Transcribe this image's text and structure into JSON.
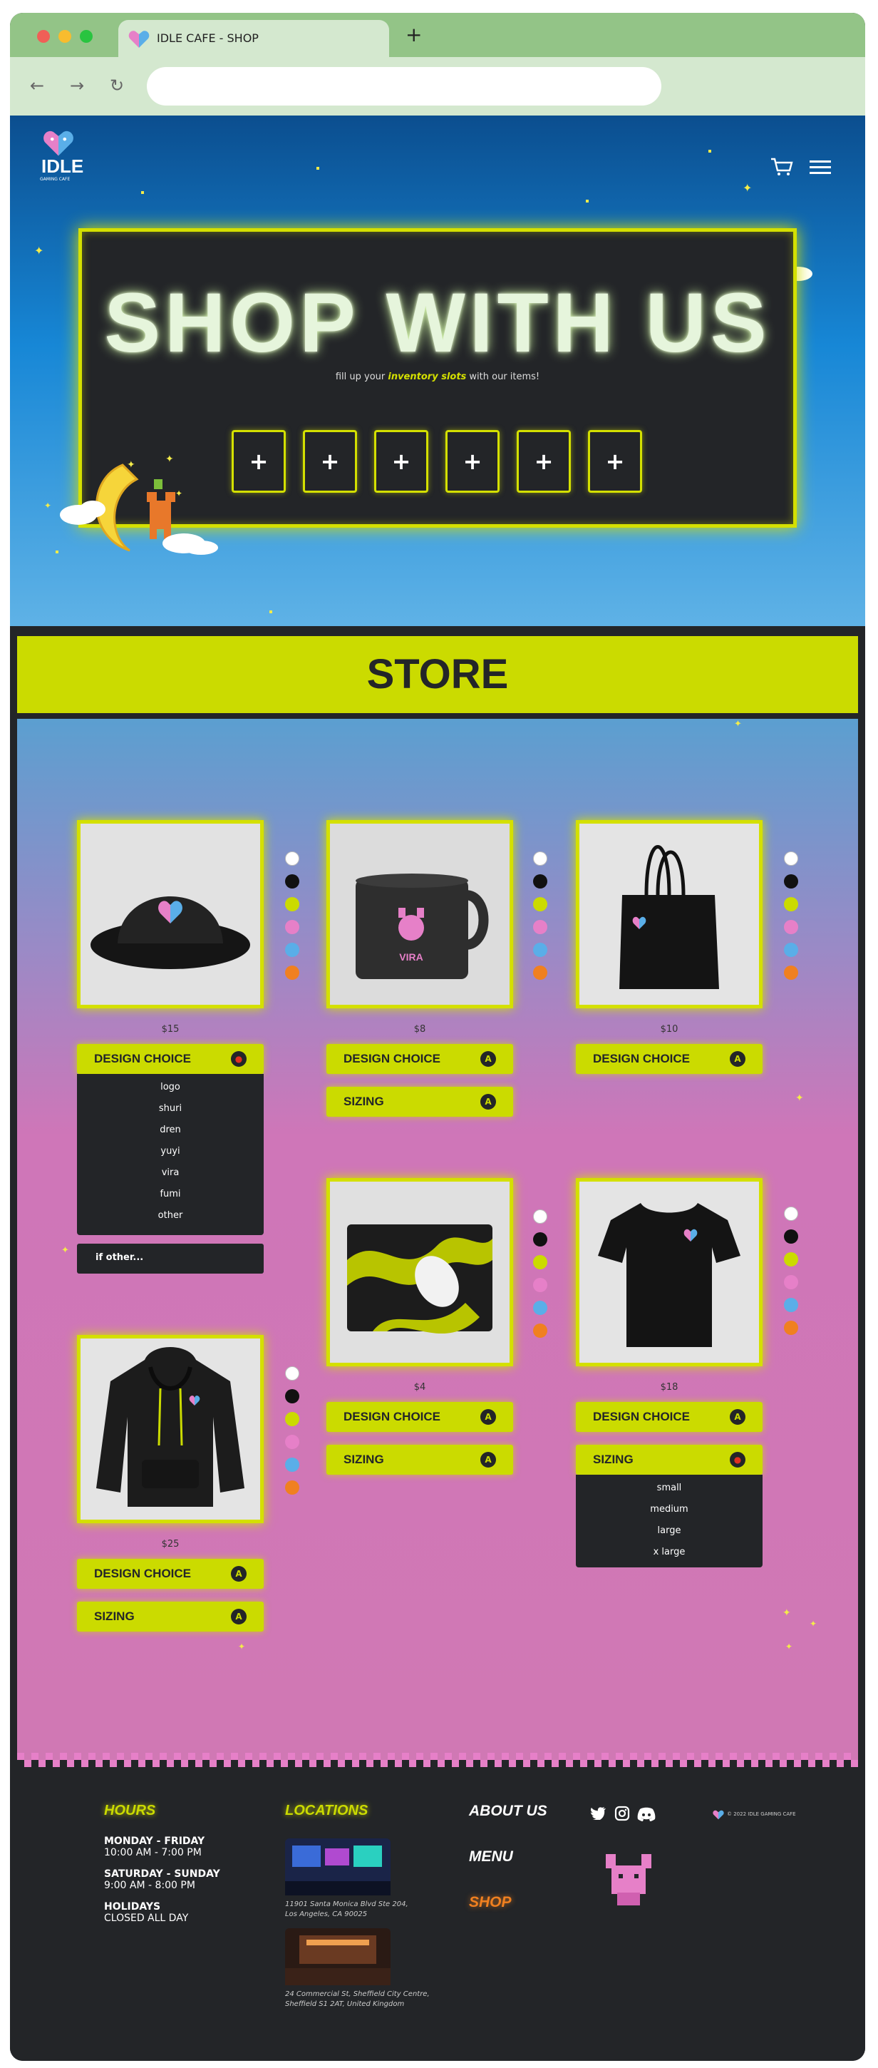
{
  "browser": {
    "tab_title": "IDLE CAFE - SHOP",
    "new_tab": "+",
    "url": ""
  },
  "header": {
    "logo_text": "IDLE",
    "logo_sub": "GAMING CAFE"
  },
  "hero": {
    "title": "SHOP WITH US",
    "subtitle_before": "fill up your ",
    "subtitle_highlight": "inventory slots",
    "subtitle_after": " with our items!",
    "slot_symbol": "+"
  },
  "store": {
    "title": "STORE",
    "products": [
      {
        "item": "bucket hat",
        "price": "$15",
        "options": [
          "DESIGN CHOICE"
        ],
        "expanded": "DESIGN CHOICE"
      },
      {
        "item": "mug",
        "price": "$8",
        "mug_text": "VIRA",
        "options": [
          "DESIGN CHOICE",
          "SIZING"
        ]
      },
      {
        "item": "tote bag",
        "price": "$10",
        "options": [
          "DESIGN CHOICE"
        ]
      },
      {
        "item": "mouse pad",
        "price": "$4",
        "options": [
          "DESIGN CHOICE",
          "SIZING"
        ]
      },
      {
        "item": "t-shirt",
        "price": "$18",
        "options": [
          "DESIGN CHOICE",
          "SIZING"
        ],
        "expanded": "SIZING"
      },
      {
        "item": "hoodie",
        "price": "$25",
        "options": [
          "DESIGN CHOICE",
          "SIZING"
        ]
      }
    ],
    "option_icon": "A",
    "design_choices": [
      "logo",
      "shuri",
      "dren",
      "yuyi",
      "vira",
      "fumi",
      "other"
    ],
    "sizes": [
      "small",
      "medium",
      "large",
      "x large"
    ],
    "if_other": "if other...",
    "swatch_colors": [
      "#ffffff",
      "#111111",
      "#cbdb00",
      "#e680c8",
      "#5aaee8",
      "#f08020"
    ]
  },
  "footer": {
    "hours_title": "HOURS",
    "hours": [
      {
        "days": "MONDAY - FRIDAY",
        "time": "10:00 AM - 7:00 PM"
      },
      {
        "days": "SATURDAY - SUNDAY",
        "time": "9:00 AM - 8:00 PM"
      },
      {
        "days": "HOLIDAYS",
        "time": "CLOSED ALL DAY"
      }
    ],
    "locations_title": "LOCATIONS",
    "locations": [
      {
        "address_1": "11901 Santa Monica Blvd Ste 204,",
        "address_2": "Los Angeles, CA 90025"
      },
      {
        "address_1": "24 Commercial St, Sheffield City Centre,",
        "address_2": "Sheffield S1 2AT, United Kingdom"
      }
    ],
    "nav": [
      "ABOUT US",
      "MENU",
      "SHOP"
    ],
    "copyright": "© 2022 IDLE GAMING CAFE"
  },
  "colors": {
    "accent": "#cbdb00",
    "dark": "#232528",
    "shop_link": "#f08020",
    "pink": "#e680c8",
    "blue": "#5aaee8"
  }
}
